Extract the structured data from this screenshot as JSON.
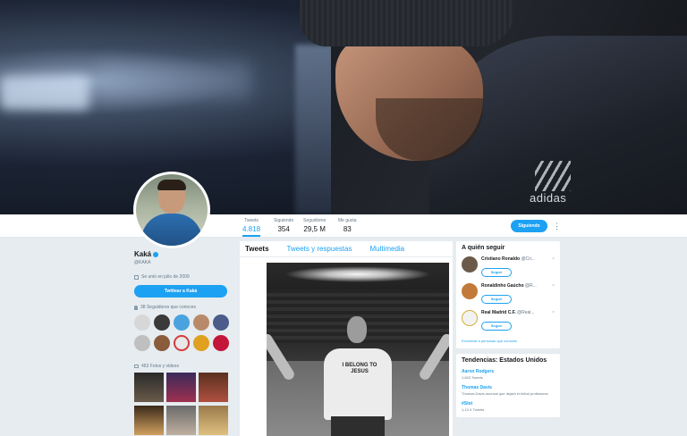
{
  "banner": {
    "brand_text": "adidas"
  },
  "profile": {
    "name": "Kaká",
    "handle": "@KAKA",
    "joined": "Se unió en julio de 2009",
    "tweet_to_label": "Twittear a Kaká",
    "known_followers_label": "38 Seguidores que conoces",
    "media_label": "463 Fotos y videos"
  },
  "stats": [
    {
      "label": "Tweets",
      "value": "4.818"
    },
    {
      "label": "Siguiendo",
      "value": "354"
    },
    {
      "label": "Seguidores",
      "value": "29,5 M"
    },
    {
      "label": "Me gusta",
      "value": "83"
    }
  ],
  "actions": {
    "follow_label": "Siguiendo",
    "more_icon": "more-dots-icon"
  },
  "tabs": [
    "Tweets",
    "Tweets y respuestas",
    "Multimedia"
  ],
  "tweet_photo": {
    "shirt_text": "I BELONG TO JESUS"
  },
  "who_to_follow": {
    "title": "A quién seguir",
    "items": [
      {
        "name": "Cristiano Ronaldo",
        "handle": "@Cri...",
        "button": "Seguir"
      },
      {
        "name": "Ronaldinho Gaúcho",
        "handle": "@R...",
        "button": "Seguir"
      },
      {
        "name": "Real Madrid C.F.",
        "handle": "@Real...",
        "button": "Seguir"
      }
    ],
    "find_people": "Encontrar a personas que conoces"
  },
  "trends": {
    "title": "Tendencias: Estados Unidos",
    "items": [
      {
        "name": "Aaron Rodgers",
        "meta": "1.843 Tweets"
      },
      {
        "name": "Thomas Davis",
        "meta": "Thomas Davis anuncia que dejará el fútbol profesional"
      },
      {
        "name": "#Stet",
        "meta": "1,13 K Tweets"
      }
    ]
  },
  "colors": {
    "accent": "#1da1f2",
    "background": "#e6ecf0"
  }
}
